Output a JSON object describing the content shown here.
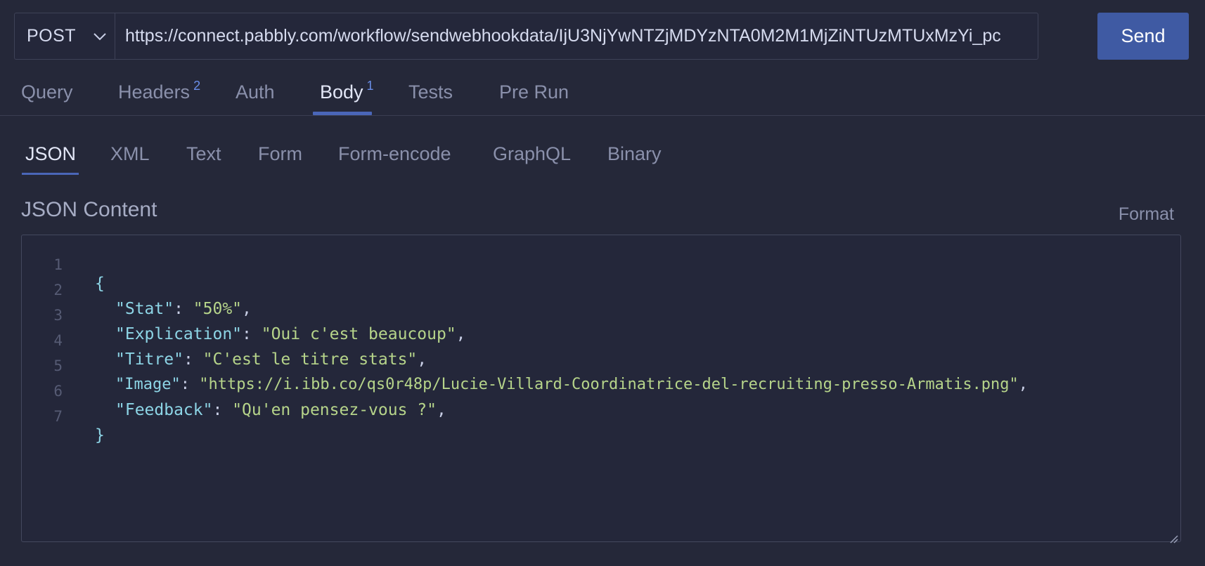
{
  "request": {
    "method": "POST",
    "url": "https://connect.pabbly.com/workflow/sendwebhookdata/IjU3NjYwNTZjMDYzNTA0M2M1MjZiNTUzMTUxMzYi_pc",
    "send_label": "Send"
  },
  "request_tabs": [
    {
      "label": "Query",
      "badge": ""
    },
    {
      "label": "Headers",
      "badge": "2"
    },
    {
      "label": "Auth",
      "badge": ""
    },
    {
      "label": "Body",
      "badge": "1",
      "active": true
    },
    {
      "label": "Tests",
      "badge": ""
    },
    {
      "label": "Pre Run",
      "badge": ""
    }
  ],
  "body_tabs": [
    {
      "label": "JSON",
      "active": true
    },
    {
      "label": "XML"
    },
    {
      "label": "Text"
    },
    {
      "label": "Form"
    },
    {
      "label": "Form-encode"
    },
    {
      "label": "GraphQL"
    },
    {
      "label": "Binary"
    }
  ],
  "editor": {
    "title": "JSON Content",
    "format_label": "Format",
    "lines": [
      {
        "num": "1",
        "open": "{"
      },
      {
        "num": "2",
        "key": "\"Stat\"",
        "sep": ": ",
        "value": "\"50%\"",
        "end": ","
      },
      {
        "num": "3",
        "key": "\"Explication\"",
        "sep": ": ",
        "value": "\"Oui c'est beaucoup\"",
        "end": ","
      },
      {
        "num": "4",
        "key": "\"Titre\"",
        "sep": ": ",
        "value": "\"C'est le titre stats\"",
        "end": ","
      },
      {
        "num": "5",
        "key": "\"Image\"",
        "sep": ": ",
        "value": "\"https://i.ibb.co/qs0r48p/Lucie-Villard-Coordinatrice-del-recruiting-presso-Armatis.png\"",
        "end": ","
      },
      {
        "num": "6",
        "key": "\"Feedback\"",
        "sep": ": ",
        "value": "\"Qu'en pensez-vous ?\"",
        "end": ","
      },
      {
        "num": "7",
        "close": "}"
      }
    ]
  },
  "colors": {
    "background": "#252839",
    "accent": "#3f5aa3",
    "json_key": "#8dd5e6",
    "json_string": "#b6d48a"
  }
}
